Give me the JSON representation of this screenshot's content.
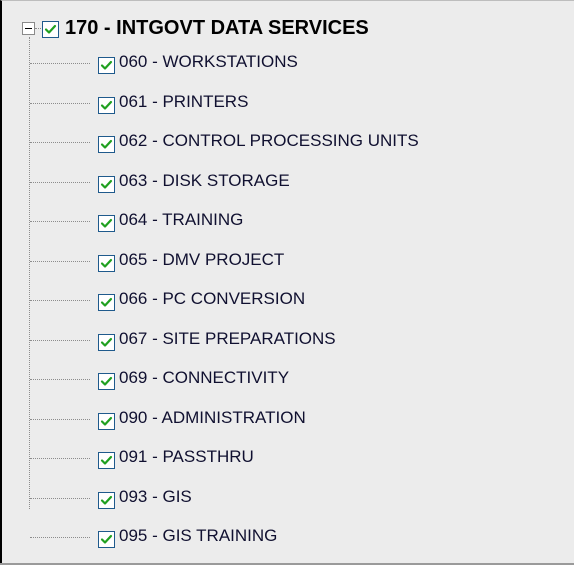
{
  "tree": {
    "root": {
      "label": "170 - INTGOVT DATA SERVICES",
      "checked": true,
      "expanded": true
    },
    "children": [
      {
        "label": "060 - WORKSTATIONS",
        "checked": true
      },
      {
        "label": "061 - PRINTERS",
        "checked": true
      },
      {
        "label": "062 - CONTROL PROCESSING UNITS",
        "checked": true
      },
      {
        "label": "063 - DISK STORAGE",
        "checked": true
      },
      {
        "label": "064 - TRAINING",
        "checked": true
      },
      {
        "label": "065 - DMV PROJECT",
        "checked": true
      },
      {
        "label": "066 - PC CONVERSION",
        "checked": true
      },
      {
        "label": "067 - SITE PREPARATIONS",
        "checked": true
      },
      {
        "label": "069 - CONNECTIVITY",
        "checked": true
      },
      {
        "label": "090 - ADMINISTRATION",
        "checked": true
      },
      {
        "label": "091 - PASSTHRU",
        "checked": true
      },
      {
        "label": "093 - GIS",
        "checked": true
      },
      {
        "label": "095 - GIS TRAINING",
        "checked": true
      }
    ]
  },
  "colors": {
    "checkmark": "#20a020",
    "checkbox_border": "#1f5a8c",
    "panel_background": "#ececec"
  },
  "icons": {
    "expander": "minus-square-icon",
    "check": "checkmark-icon"
  }
}
